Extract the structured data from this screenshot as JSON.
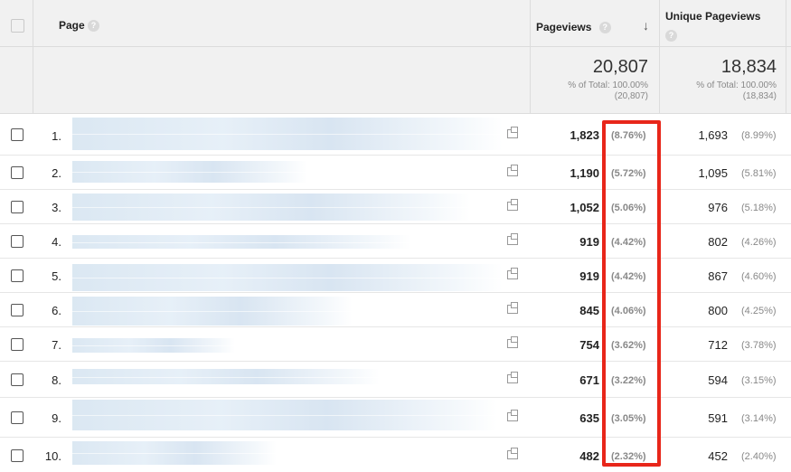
{
  "header": {
    "page_label": "Page",
    "pageviews_label": "Pageviews",
    "unique_label": "Unique Pageviews",
    "help_glyph": "?",
    "sort_glyph": "↓"
  },
  "totals": {
    "pageviews": "20,807",
    "pageviews_pct_line": "% of Total: 100.00%",
    "pageviews_abs": "(20,807)",
    "unique": "18,834",
    "unique_pct_line": "% of Total: 100.00%",
    "unique_abs": "(18,834)"
  },
  "rows": [
    {
      "index": "1.",
      "pageviews": "1,823",
      "pageviews_pct": "(8.76%)",
      "unique": "1,693",
      "unique_pct": "(8.99%)"
    },
    {
      "index": "2.",
      "pageviews": "1,190",
      "pageviews_pct": "(5.72%)",
      "unique": "1,095",
      "unique_pct": "(5.81%)"
    },
    {
      "index": "3.",
      "pageviews": "1,052",
      "pageviews_pct": "(5.06%)",
      "unique": "976",
      "unique_pct": "(5.18%)"
    },
    {
      "index": "4.",
      "pageviews": "919",
      "pageviews_pct": "(4.42%)",
      "unique": "802",
      "unique_pct": "(4.26%)"
    },
    {
      "index": "5.",
      "pageviews": "919",
      "pageviews_pct": "(4.42%)",
      "unique": "867",
      "unique_pct": "(4.60%)"
    },
    {
      "index": "6.",
      "pageviews": "845",
      "pageviews_pct": "(4.06%)",
      "unique": "800",
      "unique_pct": "(4.25%)"
    },
    {
      "index": "7.",
      "pageviews": "754",
      "pageviews_pct": "(3.62%)",
      "unique": "712",
      "unique_pct": "(3.78%)"
    },
    {
      "index": "8.",
      "pageviews": "671",
      "pageviews_pct": "(3.22%)",
      "unique": "594",
      "unique_pct": "(3.15%)"
    },
    {
      "index": "9.",
      "pageviews": "635",
      "pageviews_pct": "(3.05%)",
      "unique": "591",
      "unique_pct": "(3.14%)"
    },
    {
      "index": "10.",
      "pageviews": "482",
      "pageviews_pct": "(2.32%)",
      "unique": "452",
      "unique_pct": "(2.40%)"
    }
  ],
  "colors": {
    "highlight": "#e8261a",
    "header_bg": "#f1f1f1",
    "redacted_blue": "#d7e5f1"
  }
}
